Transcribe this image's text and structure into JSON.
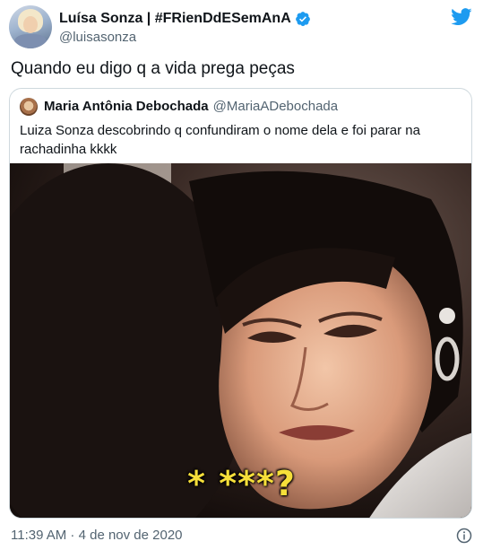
{
  "author": {
    "display_name": "Luísa Sonza | #FRienDdESemAnA",
    "handle": "@luisasonza",
    "verified": true
  },
  "tweet": {
    "text": "Quando eu digo q a vida prega peças"
  },
  "quoted_tweet": {
    "display_name": "Maria Antônia Debochada",
    "handle": "@MariaADebochada",
    "text": "Luiza Sonza descobrindo q confundiram o nome dela e foi parar na rachadinha kkkk",
    "media_caption": "* ***?"
  },
  "footer": {
    "timestamp": "11:39 AM · 4 de nov de 2020"
  },
  "icons": {
    "brand": "twitter-bird-icon",
    "verified": "verified-badge-icon",
    "info": "info-icon"
  },
  "colors": {
    "brand_blue": "#1d9bf0",
    "secondary_text": "#536471",
    "caption_yellow": "#f6df3a"
  }
}
